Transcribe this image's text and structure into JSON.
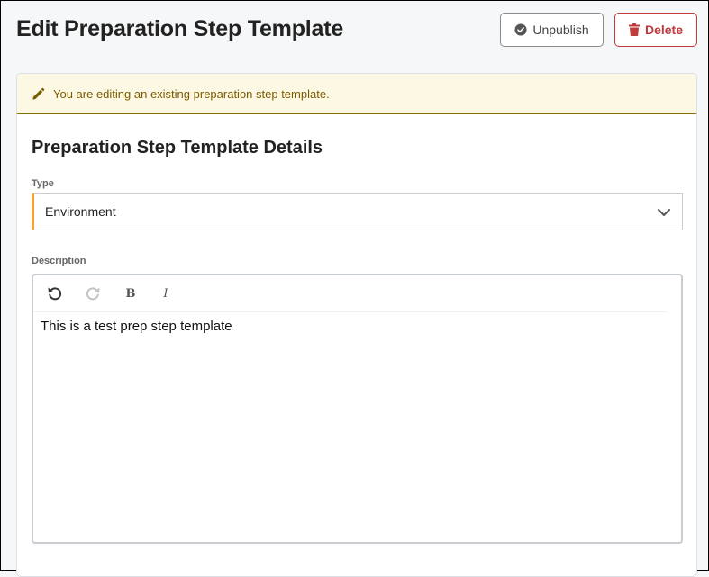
{
  "header": {
    "title": "Edit Preparation Step Template",
    "unpublish_label": "Unpublish",
    "delete_label": "Delete"
  },
  "alert": {
    "message": "You are editing an existing preparation step template."
  },
  "details": {
    "section_title": "Preparation Step Template Details",
    "type_label": "Type",
    "type_value": "Environment",
    "description_label": "Description",
    "description_value": "This is a test prep step template"
  },
  "toolbar": {
    "bold_label": "B",
    "italic_label": "I"
  },
  "icons": {
    "unpublish": "check-circle-icon",
    "delete": "trash-icon",
    "alert": "pencil-icon",
    "select": "chevron-down-icon",
    "undo": "undo-icon",
    "redo": "redo-icon"
  },
  "colors": {
    "delete_accent": "#c0393b",
    "alert_bg": "#fdf8e4",
    "alert_text": "#7a5c00",
    "select_accent": "#f0a23b"
  }
}
